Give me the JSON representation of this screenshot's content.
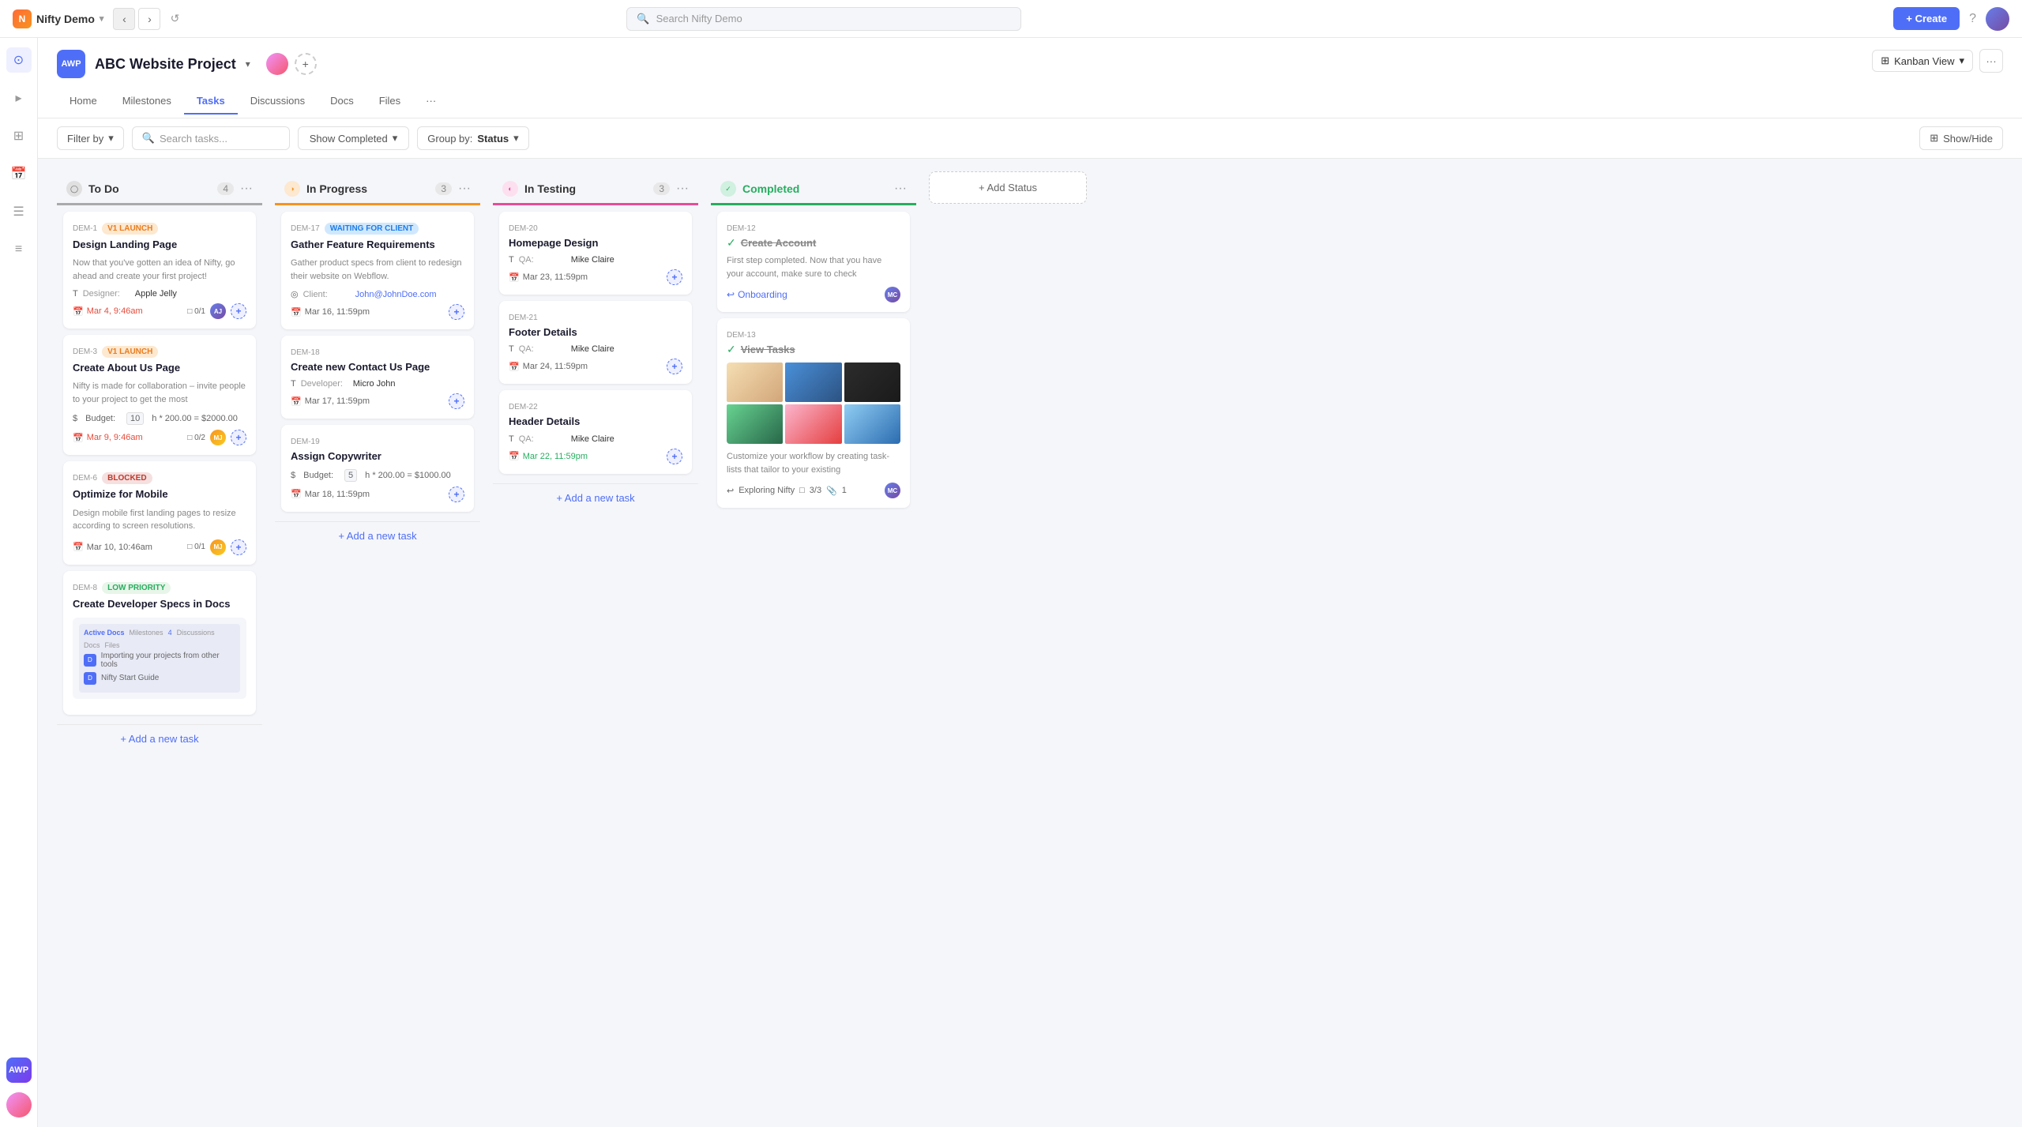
{
  "app": {
    "name": "Nifty Demo",
    "dropdown": "▾"
  },
  "topbar": {
    "search_placeholder": "Search Nifty Demo",
    "create_label": "+ Create"
  },
  "project": {
    "badge": "AWP",
    "title": "ABC Website Project",
    "tabs": [
      "Home",
      "Milestones",
      "Tasks",
      "Discussions",
      "Docs",
      "Files",
      "..."
    ],
    "active_tab": "Tasks",
    "view": "Kanban View"
  },
  "toolbar": {
    "filter_label": "Filter by",
    "search_placeholder": "Search tasks...",
    "show_completed_label": "Show Completed",
    "group_by_label": "Group by:",
    "group_by_value": "Status",
    "show_hide_label": "Show/Hide"
  },
  "columns": [
    {
      "id": "todo",
      "title": "To Do",
      "count": 4,
      "color": "#aaa",
      "cards": [
        {
          "id": "DEM-1",
          "badges": [
            "V1 LAUNCH"
          ],
          "badge_types": [
            "v1"
          ],
          "title": "Design Landing Page",
          "desc": "Now that you've gotten an idea of Nifty, go ahead and create your first project!",
          "meta": [
            {
              "icon": "T",
              "label": "Designer:",
              "value": "Apple Jelly"
            }
          ],
          "date": "Mar 4, 9:46am",
          "date_color": "red",
          "subtasks": "0/1",
          "avatars": [
            "AJ",
            "add"
          ]
        },
        {
          "id": "DEM-3",
          "badges": [
            "V1 LAUNCH"
          ],
          "badge_types": [
            "v1"
          ],
          "title": "Create About Us Page",
          "desc": "Nifty is made for collaboration – invite people to your project to get the most",
          "budget": "10",
          "budget_formula": "h * 200.00 = $2000.00",
          "date": "Mar 9, 9:46am",
          "date_color": "red",
          "subtasks": "0/2",
          "avatars": [
            "MJ",
            "add"
          ]
        },
        {
          "id": "DEM-6",
          "badges": [
            "BLOCKED"
          ],
          "badge_types": [
            "blocked"
          ],
          "title": "Optimize for Mobile",
          "desc": "Design mobile first landing pages to resize according to screen resolutions.",
          "date": "Mar 10, 10:46am",
          "date_color": "normal",
          "subtasks": "0/1",
          "avatars": [
            "MJ",
            "add"
          ]
        },
        {
          "id": "DEM-8",
          "badges": [
            "LOW PRIORITY"
          ],
          "badge_types": [
            "low-priority"
          ],
          "title": "Create Developer Specs in Docs",
          "desc": "",
          "date": null,
          "has_doc_preview": true
        }
      ]
    },
    {
      "id": "inprogress",
      "title": "In Progress",
      "count": 3,
      "color": "#f7931e",
      "cards": [
        {
          "id": "DEM-17",
          "badges": [
            "WAITING FOR CLIENT"
          ],
          "badge_types": [
            "waiting"
          ],
          "title": "Gather Feature Requirements",
          "desc": "Gather product specs from client to redesign their website on Webflow.",
          "meta": [
            {
              "icon": "◎",
              "label": "Client:",
              "value": "John@JohnDoe.com"
            }
          ],
          "date": "Mar 16, 11:59pm",
          "date_color": "normal",
          "avatars": [
            "add"
          ]
        },
        {
          "id": "DEM-18",
          "badges": [],
          "badge_types": [],
          "title": "Create new Contact Us Page",
          "meta": [
            {
              "icon": "T",
              "label": "Developer:",
              "value": "Micro John"
            }
          ],
          "date": "Mar 17, 11:59pm",
          "date_color": "normal",
          "avatars": [
            "add"
          ]
        },
        {
          "id": "DEM-19",
          "badges": [],
          "badge_types": [],
          "title": "Assign Copywriter",
          "budget": "5",
          "budget_formula": "h * 200.00 = $1000.00",
          "date": "Mar 18, 11:59pm",
          "date_color": "normal",
          "avatars": [
            "add"
          ]
        }
      ]
    },
    {
      "id": "intesting",
      "title": "In Testing",
      "count": 3,
      "color": "#e74c9a",
      "cards": [
        {
          "id": "DEM-20",
          "badges": [],
          "badge_types": [],
          "title": "Homepage Design",
          "meta": [
            {
              "icon": "T",
              "label": "QA:",
              "value": "Mike Claire"
            }
          ],
          "date": "Mar 23, 11:59pm",
          "date_color": "normal",
          "avatars": [
            "add"
          ]
        },
        {
          "id": "DEM-21",
          "badges": [],
          "badge_types": [],
          "title": "Footer Details",
          "meta": [
            {
              "icon": "T",
              "label": "QA:",
              "value": "Mike Claire"
            }
          ],
          "date": "Mar 24, 11:59pm",
          "date_color": "normal",
          "avatars": [
            "add"
          ]
        },
        {
          "id": "DEM-22",
          "badges": [],
          "badge_types": [],
          "title": "Header Details",
          "meta": [
            {
              "icon": "T",
              "label": "QA:",
              "value": "Mike Claire"
            }
          ],
          "date": "Mar 22, 11:59pm",
          "date_color": "green",
          "avatars": [
            "add"
          ]
        }
      ]
    },
    {
      "id": "completed",
      "title": "Completed",
      "count": null,
      "color": "#27ae60",
      "cards": [
        {
          "id": "DEM-12",
          "completed_title": "Create Account",
          "desc": "First step completed. Now that you have your account, make sure to check",
          "onboarding_link": "Onboarding",
          "avatar": "MC"
        },
        {
          "id": "DEM-13",
          "completed_title": "View Tasks",
          "has_images": true,
          "desc": "Customize your workflow by creating task-lists that tailor to your existing",
          "subtasks_label": "Exploring Nifty",
          "subtasks_count": "3/3",
          "attachments": "1",
          "avatar": "MC"
        }
      ]
    }
  ],
  "add_status": "+ Add Status"
}
